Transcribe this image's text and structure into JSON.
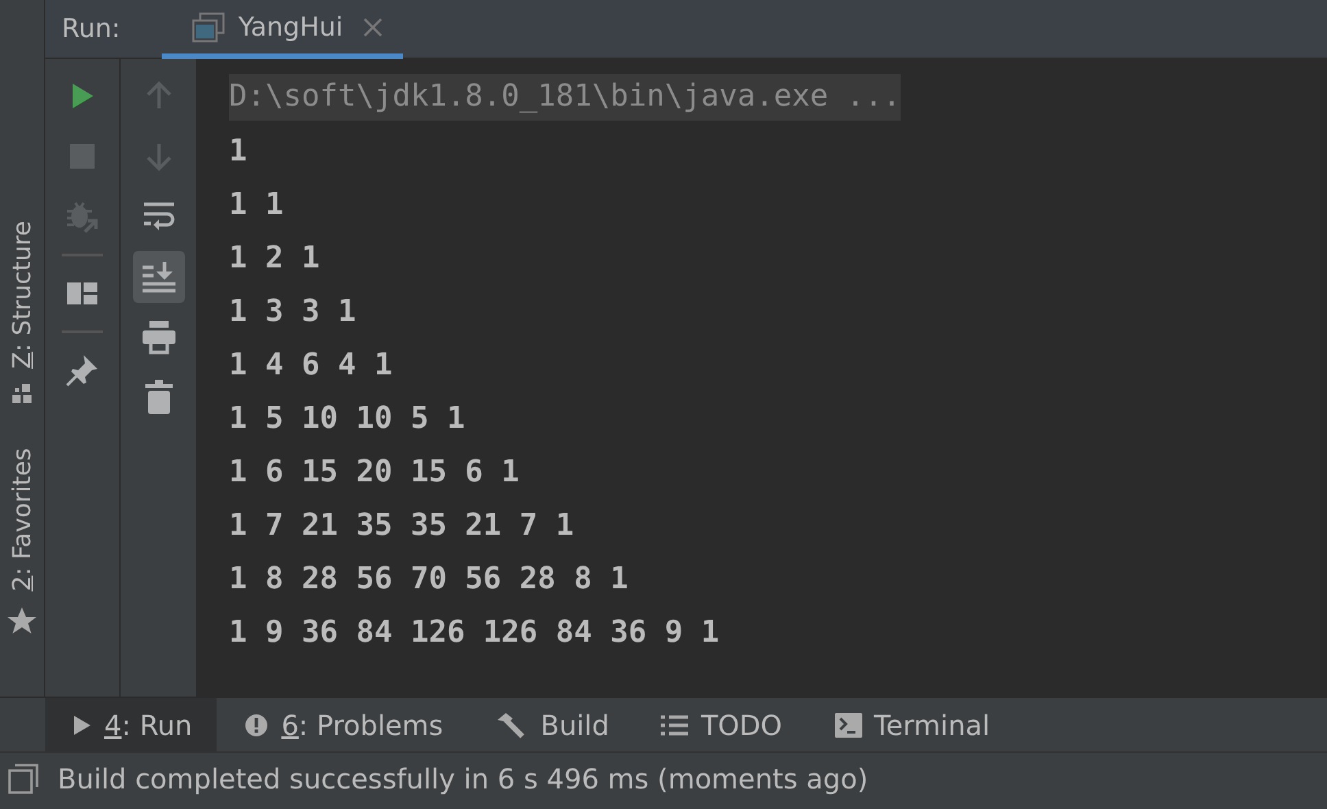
{
  "left_stripe": [
    {
      "kind": "structure",
      "mnemonic": "Z",
      "rest": ": Structure"
    },
    {
      "kind": "favorites",
      "mnemonic": "2",
      "rest": ": Favorites"
    }
  ],
  "run_header": {
    "label": "Run:",
    "tabs": [
      {
        "label": "YangHui",
        "selected": true
      }
    ]
  },
  "toolbar_left": [
    {
      "kind": "run",
      "disabled": false
    },
    {
      "kind": "stop",
      "disabled": true
    },
    {
      "kind": "debug",
      "disabled": true
    },
    {
      "kind": "divider"
    },
    {
      "kind": "layout",
      "disabled": false
    },
    {
      "kind": "divider"
    },
    {
      "kind": "pin",
      "disabled": false
    }
  ],
  "toolbar_right": [
    {
      "kind": "up",
      "disabled": true
    },
    {
      "kind": "down",
      "disabled": true
    },
    {
      "kind": "wrap",
      "disabled": false,
      "on": false
    },
    {
      "kind": "scroll-end",
      "disabled": false,
      "on": true
    },
    {
      "kind": "print",
      "disabled": false
    },
    {
      "kind": "trash",
      "disabled": false
    }
  ],
  "console": [
    {
      "kind": "command",
      "text": "D:\\soft\\jdk1.8.0_181\\bin\\java.exe ..."
    },
    {
      "kind": "output",
      "text": "1"
    },
    {
      "kind": "output",
      "text": "1 1"
    },
    {
      "kind": "output",
      "text": "1 2 1"
    },
    {
      "kind": "output",
      "text": "1 3 3 1"
    },
    {
      "kind": "output",
      "text": "1 4 6 4 1"
    },
    {
      "kind": "output",
      "text": "1 5 10 10 5 1"
    },
    {
      "kind": "output",
      "text": "1 6 15 20 15 6 1"
    },
    {
      "kind": "output",
      "text": "1 7 21 35 35 21 7 1"
    },
    {
      "kind": "output",
      "text": "1 8 28 56 70 56 28 8 1"
    },
    {
      "kind": "output",
      "text": "1 9 36 84 126 126 84 36 9 1"
    }
  ],
  "tool_tabs": [
    {
      "kind": "run",
      "mnemonic": "4",
      "rest": ": Run",
      "selected": true
    },
    {
      "kind": "problems",
      "mnemonic": "6",
      "rest": ": Problems",
      "selected": false
    },
    {
      "kind": "build",
      "rest": "Build",
      "selected": false
    },
    {
      "kind": "todo",
      "rest": "TODO",
      "selected": false
    },
    {
      "kind": "terminal",
      "rest": "Terminal",
      "selected": false
    }
  ],
  "status_bar": {
    "text": "Build completed successfully in 6 s 496 ms (moments ago)"
  }
}
